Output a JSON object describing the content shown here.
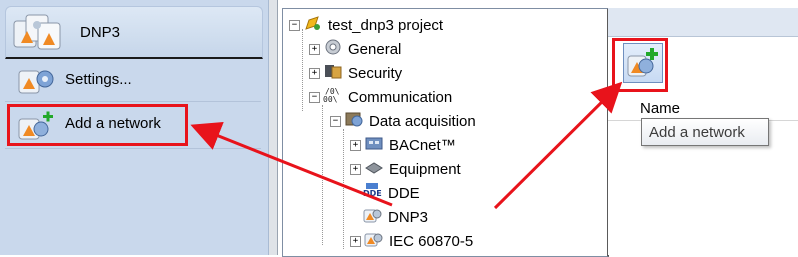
{
  "left_panel": {
    "header_title": "DNP3",
    "items": [
      {
        "label": "Settings...",
        "icon": "settings-icon"
      },
      {
        "label": "Add a network",
        "icon": "add-network-icon"
      }
    ]
  },
  "tree": {
    "root": "test_dnp3 project",
    "nodes": [
      {
        "label": "General",
        "expander": "+"
      },
      {
        "label": "Security",
        "expander": "+"
      },
      {
        "label": "Communication",
        "expander": "−"
      },
      {
        "label": "Data acquisition",
        "expander": "−"
      },
      {
        "label": "BACnet™",
        "expander": "+"
      },
      {
        "label": "Equipment",
        "expander": "+"
      },
      {
        "label": "DDE",
        "expander": ""
      },
      {
        "label": "DNP3",
        "expander": ""
      },
      {
        "label": "IEC 60870-5",
        "expander": "+"
      }
    ]
  },
  "right_panel": {
    "column_header": "Name",
    "tooltip": "Add a network"
  },
  "colors": {
    "highlight": "#e8131b",
    "nav_background": "#c9d8ec"
  }
}
